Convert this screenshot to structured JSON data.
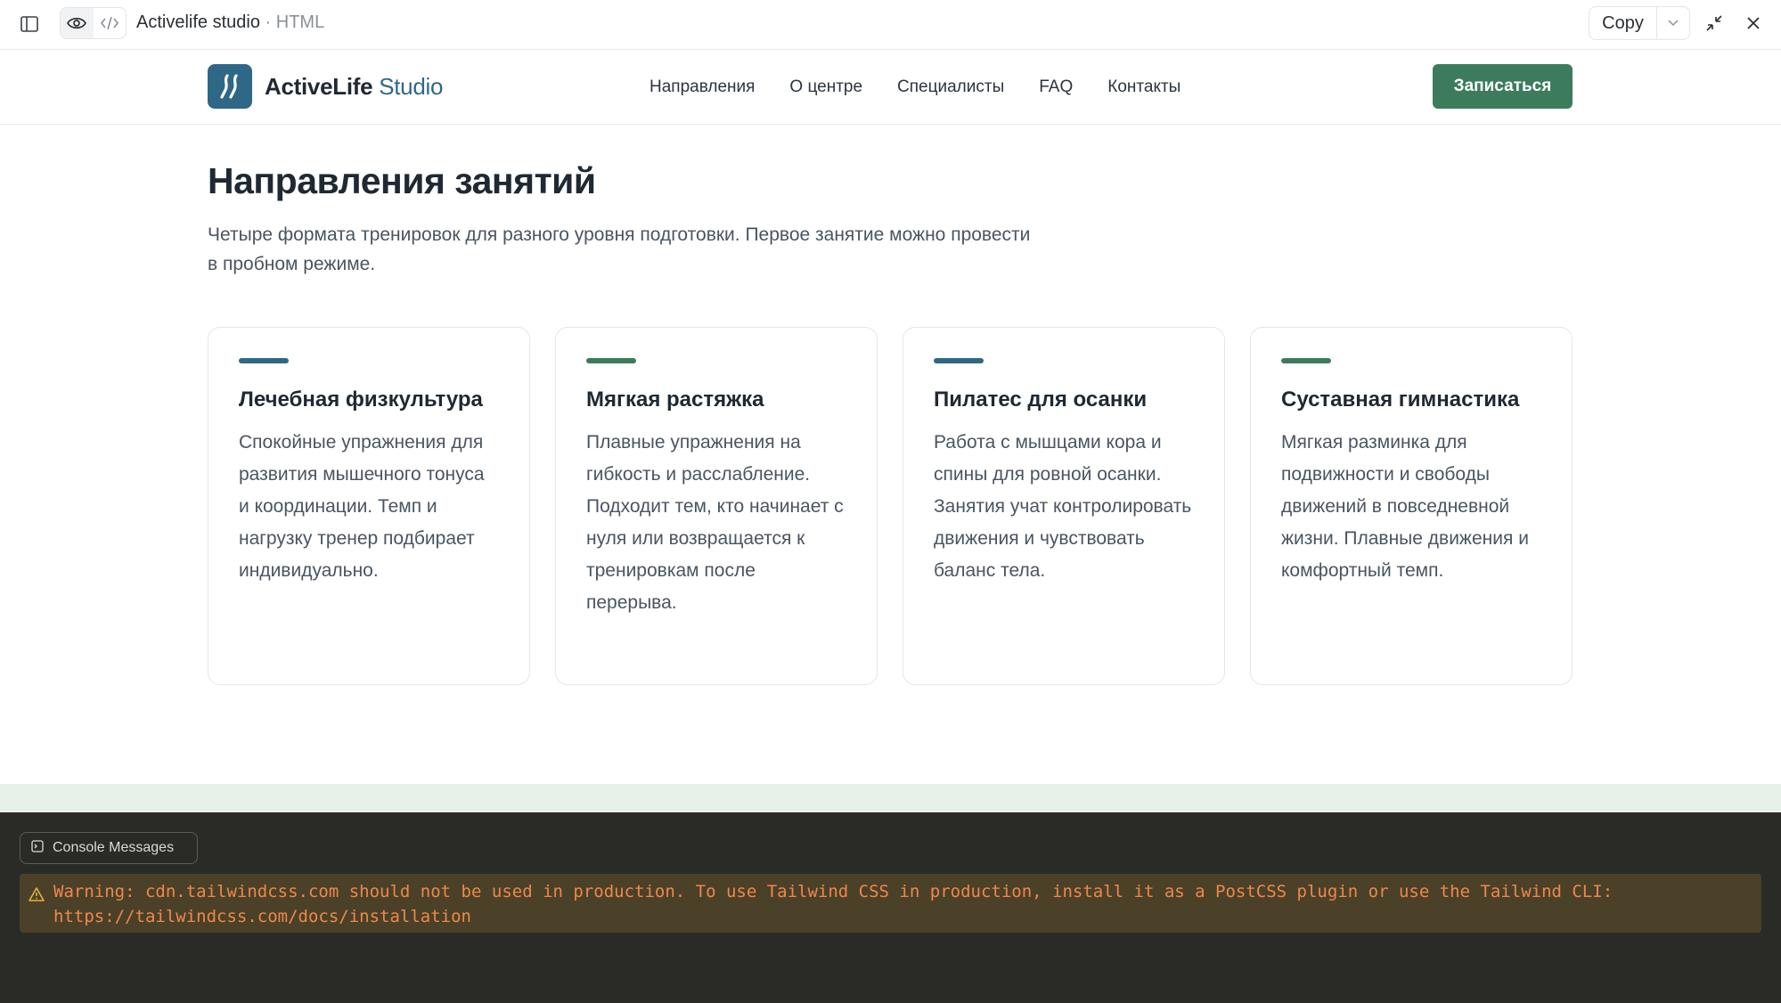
{
  "toolbar": {
    "title": "Activelife studio",
    "title_suffix": "· HTML",
    "copy_label": "Copy"
  },
  "header": {
    "logo_main": "ActiveLife",
    "logo_sub": "Studio",
    "nav": [
      "Направления",
      "О центре",
      "Специалисты",
      "FAQ",
      "Контакты"
    ],
    "cta_label": "Записаться"
  },
  "main": {
    "title": "Направления занятий",
    "lead": "Четыре формата тренировок для разного уровня подготовки. Первое занятие можно провести в пробном режиме.",
    "cards": [
      {
        "title": "Лечебная физкультура",
        "text": "Спокойные упражнения для развития мышечного тонуса и координации. Темп и нагрузку тренер подбирает индивидуально.",
        "accent": "#2f6886"
      },
      {
        "title": "Мягкая растяжка",
        "text": "Плавные упражнения на гибкость и расслабление. Подходит тем, кто начинает с нуля или возвращается к тренировкам после перерыва.",
        "accent": "#3c7c5c"
      },
      {
        "title": "Пилатес для осанки",
        "text": "Работа с мышцами кора и спины для ровной осанки. Занятия учат контролировать движения и чувствовать баланс тела.",
        "accent": "#2f6886"
      },
      {
        "title": "Суставная гимнастика",
        "text": "Мягкая разминка для подвижности и свободы движений в повседневной жизни. Плавные движения и комфортный темп.",
        "accent": "#3c7c5c"
      }
    ]
  },
  "console": {
    "button_label": "Console Messages",
    "warning_line1": "Warning: cdn.tailwindcss.com should not be used in production. To use Tailwind CSS in production, install it as a PostCSS plugin or use the Tailwind CLI:",
    "warning_line2": "https://tailwindcss.com/docs/installation"
  },
  "colors": {
    "brand_blue": "#2f6886",
    "brand_green": "#3c7c5c",
    "warning_text": "#f0874b"
  },
  "icons": [
    "sidebar-icon",
    "eye-icon",
    "code-icon",
    "chevron-down-icon",
    "collapse-icon",
    "close-icon",
    "logo-icon",
    "terminal-icon",
    "warning-icon"
  ]
}
